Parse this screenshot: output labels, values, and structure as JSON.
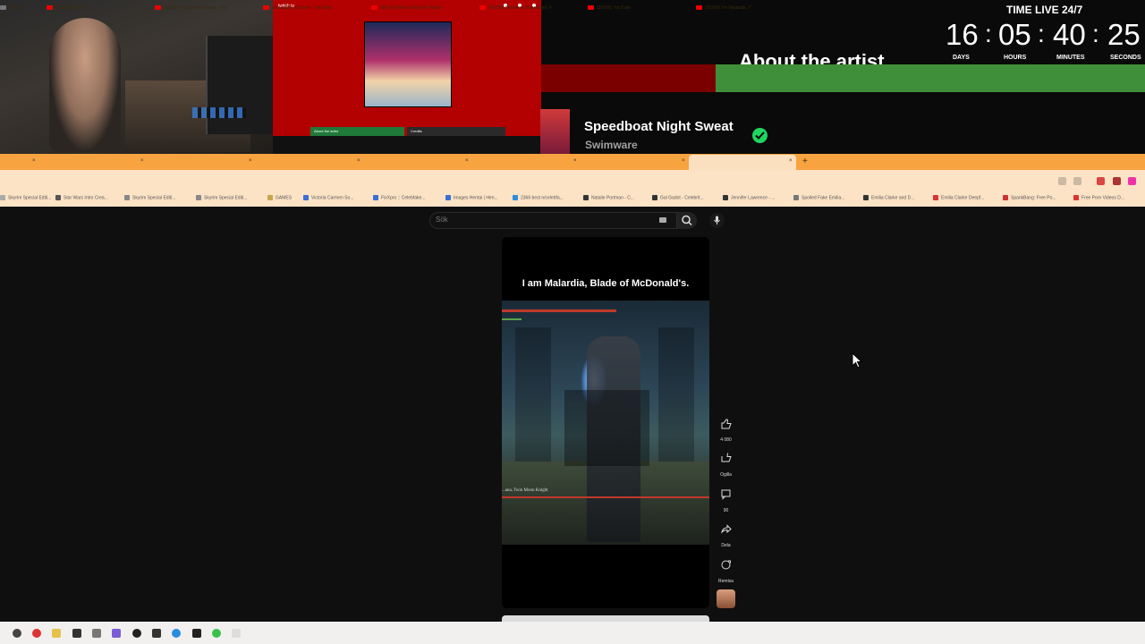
{
  "stream": {
    "timer_label": "TIME LIVE 24/7",
    "timer": {
      "days": "16",
      "hours": "05",
      "minutes": "40",
      "seconds": "25",
      "days_label": "DAYS",
      "hours_label": "HOURS",
      "minutes_label": "MINUTES",
      "seconds_label": "SECONDS"
    },
    "about_artist": "About the artist",
    "track_title": "Speedboat Night Sweat",
    "track_artist": "Swimware",
    "mini_about": "About the artist",
    "mini_credits": "Credits",
    "mini_title": "twitch tv"
  },
  "browser": {
    "tabs": [
      {
        "label": "Playlist",
        "icon": "folder-icon"
      },
      {
        "label": "(30290) YouTube",
        "icon": "youtube-icon"
      },
      {
        "label": "(30290) I Finally beat sans - You",
        "icon": "youtube-icon"
      },
      {
        "label": "you laugh, you lose - YouTube",
        "icon": "youtube-icon"
      },
      {
        "label": "Why Did Harry Drop the Resurr",
        "icon": "youtube-icon"
      },
      {
        "label": "(30290) Streamer Showdown! F",
        "icon": "youtube-icon"
      },
      {
        "label": "(30290) YouTube",
        "icon": "youtube-icon"
      },
      {
        "label": "(30290) I'm Malardia, Y",
        "icon": "youtube-icon",
        "active": true
      }
    ],
    "bookmarks": [
      "Skyrim Special Editi...",
      "Star Wars Intro Crea...",
      "Skyrim Special Editi...",
      "Skyrim Special Editi...",
      "GAMES",
      "Victoria Carmen So...",
      "FixXpro :: Celebfake...",
      "Images Hentai | Hen...",
      "2366 best n/celebfa...",
      "Natalie Portman - C...",
      "Gal Gadot - Celebrit...",
      "Jennifer Lawrence - ...",
      "Spoiled Fake Emilia...",
      "Emilia Clarke and D...",
      "Emilia Clarke Deepf...",
      "SpankBang: Free Po...",
      "Free Porn Videos D..."
    ]
  },
  "youtube": {
    "search_placeholder": "Sök",
    "short_caption": "I am Malardia, Blade of McDonald's.",
    "boss_name": "...ana, Twin Moon Knight",
    "actions": {
      "like_count": "4 080",
      "dislike_label": "Ogilla",
      "comment_count": "90",
      "share_label": "Dela",
      "remix_label": "Remixa"
    }
  },
  "colors": {
    "tabstrip": "#f7a340",
    "toolbar": "#fce3c5",
    "spotify_green": "#1ed760",
    "youtube_bg": "#0f0f0f"
  }
}
